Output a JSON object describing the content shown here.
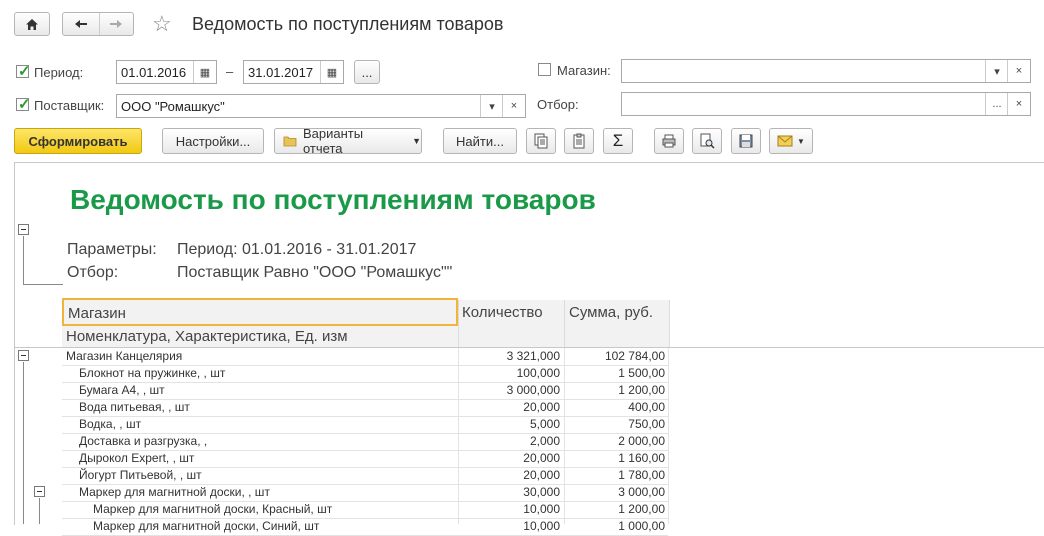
{
  "window": {
    "title": "Ведомость по поступлениям товаров"
  },
  "nav": {
    "home_icon": "home-icon",
    "back_icon": "arrow-left-icon",
    "forward_icon": "arrow-right-icon",
    "favorite_icon": "star-icon"
  },
  "filters": {
    "period_label": "Период:",
    "period_from": "01.01.2016",
    "period_dash": "–",
    "period_to": "31.01.2017",
    "period_more": "...",
    "supplier_label": "Поставщик:",
    "supplier_value": "ООО \"Ромашкус\"",
    "shop_label": "Магазин:",
    "shop_value": "",
    "selection_label": "Отбор:",
    "selection_value": "",
    "more": "...",
    "clear": "×",
    "dropdown": "▾"
  },
  "toolbar": {
    "generate": "Сформировать",
    "settings": "Настройки...",
    "variants": "Варианты отчета",
    "find": "Найти...",
    "sum_symbol": "Σ"
  },
  "report": {
    "title": "Ведомость по поступлениям товаров",
    "params_label": "Параметры:",
    "params_value": "Период: 01.01.2016 - 31.01.2017",
    "filter_label": "Отбор:",
    "filter_value": "Поставщик Равно \"ООО \"Ромашкус\"\"",
    "header": {
      "col1_line1": "Магазин",
      "col1_line2": "Номенклатура, Характеристика, Ед. изм",
      "col2": "Количество",
      "col3": "Сумма, руб."
    },
    "rows": [
      {
        "name": "Магазин Канцелярия",
        "qty": "3 321,000",
        "sum": "102 784,00",
        "level": 0
      },
      {
        "name": "Блокнот на пружинке, , шт",
        "qty": "100,000",
        "sum": "1 500,00",
        "level": 1
      },
      {
        "name": "Бумага А4, , шт",
        "qty": "3 000,000",
        "sum": "1 200,00",
        "level": 1
      },
      {
        "name": "Вода питьевая, , шт",
        "qty": "20,000",
        "sum": "400,00",
        "level": 1
      },
      {
        "name": "Водка, , шт",
        "qty": "5,000",
        "sum": "750,00",
        "level": 1
      },
      {
        "name": "Доставка и разгрузка, ,",
        "qty": "2,000",
        "sum": "2 000,00",
        "level": 1
      },
      {
        "name": "Дырокол Expert, , шт",
        "qty": "20,000",
        "sum": "1 160,00",
        "level": 1
      },
      {
        "name": "Йогурт Питьевой, , шт",
        "qty": "20,000",
        "sum": "1 780,00",
        "level": 1
      },
      {
        "name": "Маркер для магнитной доски, , шт",
        "qty": "30,000",
        "sum": "3 000,00",
        "level": 1
      },
      {
        "name": "Маркер для магнитной доски, Красный, шт",
        "qty": "10,000",
        "sum": "1 200,00",
        "level": 2
      },
      {
        "name": "Маркер для магнитной доски, Синий, шт",
        "qty": "10,000",
        "sum": "1 000,00",
        "level": 2
      }
    ]
  },
  "colors": {
    "accent_yellow": "#f5d21b",
    "title_green": "#1a9a48",
    "check_green": "#2c9a2c",
    "header_border": "#f0b43c"
  }
}
